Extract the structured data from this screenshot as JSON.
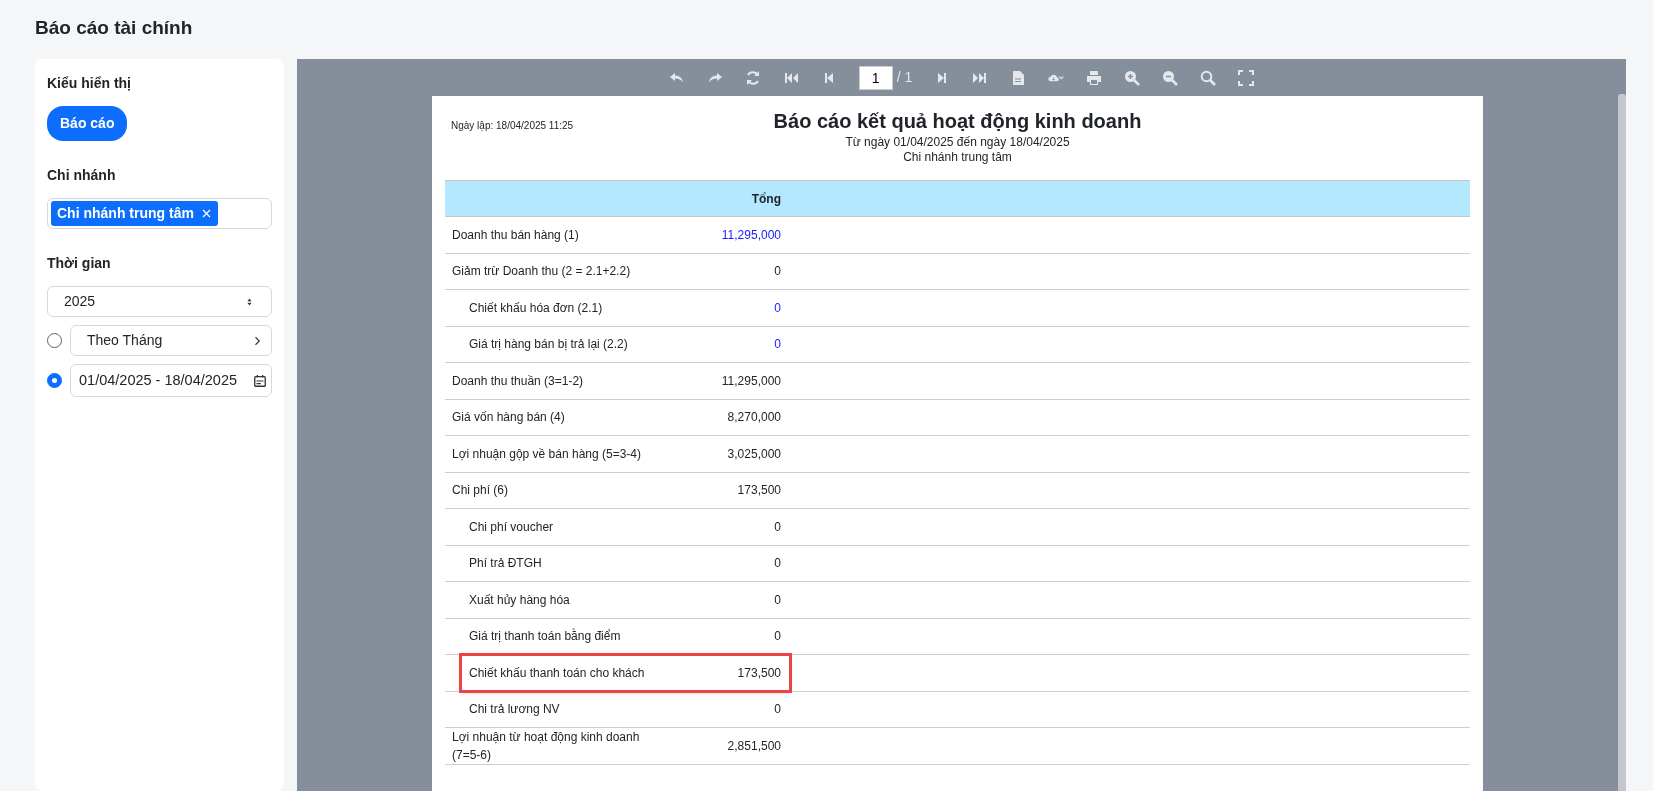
{
  "page_title": "Báo cáo tài chính",
  "sidebar": {
    "display_label": "Kiểu hiển thị",
    "display_button": "Báo cáo",
    "branch_label": "Chi nhánh",
    "branch_tags": [
      "Chi nhánh trung tâm"
    ],
    "time_label": "Thời gian",
    "year": "2025",
    "time_options": [
      {
        "kind": "menu",
        "value": "Theo Tháng",
        "selected": false
      },
      {
        "kind": "daterange",
        "value": "01/04/2025 - 18/04/2025",
        "selected": true
      }
    ]
  },
  "viewer": {
    "page_input": "1",
    "page_total": "/ 1",
    "report": {
      "created": "Ngày lập: 18/04/2025 11:25",
      "title": "Báo cáo kết quả hoạt động kinh doanh",
      "subtitle": "Từ ngày 01/04/2025 đến ngày 18/04/2025",
      "branch": "Chi nhánh trung tâm",
      "columns": [
        "Tổng"
      ],
      "rows": [
        {
          "label": "Doanh thu bán hàng (1)",
          "value": "11,295,000",
          "link": true,
          "highlighted": false
        },
        {
          "label": "Giảm trừ Doanh thu (2 = 2.1+2.2)",
          "value": "0",
          "link": false,
          "highlighted": false,
          "children": [
            {
              "label": "Chiết khấu hóa đơn (2.1)",
              "value": "0",
              "link": true,
              "highlighted": false
            },
            {
              "label": "Giá trị hàng bán bị trả lại (2.2)",
              "value": "0",
              "link": true,
              "highlighted": false
            }
          ]
        },
        {
          "label": "Doanh thu thuần (3=1-2)",
          "value": "11,295,000",
          "link": false,
          "highlighted": false
        },
        {
          "label": "Giá vốn hàng bán (4)",
          "value": "8,270,000",
          "link": false,
          "highlighted": false
        },
        {
          "label": "Lợi nhuận gộp về bán hàng (5=3-4)",
          "value": "3,025,000",
          "link": false,
          "highlighted": false
        },
        {
          "label": "Chi phí (6)",
          "value": "173,500",
          "link": false,
          "highlighted": false,
          "children": [
            {
              "label": "Chi phí voucher",
              "value": "0",
              "link": false,
              "highlighted": false
            },
            {
              "label": "Phí trả ĐTGH",
              "value": "0",
              "link": false,
              "highlighted": false
            },
            {
              "label": "Xuất hủy hàng hóa",
              "value": "0",
              "link": false,
              "highlighted": false
            },
            {
              "label": "Giá trị thanh toán bằng điểm",
              "value": "0",
              "link": false,
              "highlighted": false
            },
            {
              "label": "Chiết khấu thanh toán cho khách",
              "value": "173,500",
              "link": false,
              "highlighted": true
            },
            {
              "label": "Chi trả lương NV",
              "value": "0",
              "link": false,
              "highlighted": false
            }
          ]
        },
        {
          "label": "Lợi nhuận từ hoạt động kinh doanh (7=5-6)",
          "value": "2,851,500",
          "link": false,
          "highlighted": false
        }
      ]
    }
  }
}
